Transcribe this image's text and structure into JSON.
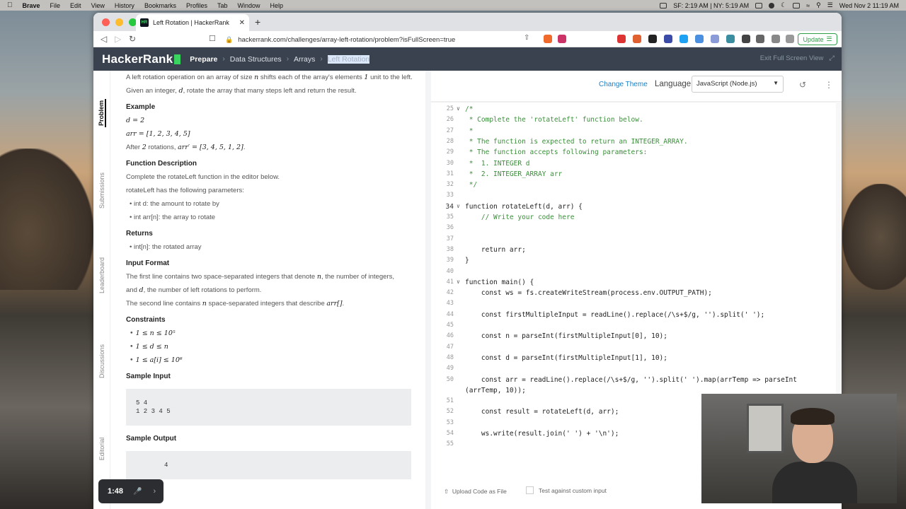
{
  "menubar": {
    "app": "Brave",
    "items": [
      "File",
      "Edit",
      "View",
      "History",
      "Bookmarks",
      "Profiles",
      "Tab",
      "Window",
      "Help"
    ],
    "clock": "SF: 2:19 AM | NY: 5:19 AM",
    "datetime": "Wed Nov 2  11:19 AM"
  },
  "browser": {
    "tab_title": "Left Rotation | HackerRank",
    "url": "hackerrank.com/challenges/array-left-rotation/problem?isFullScreen=true",
    "update_label": "Update"
  },
  "header": {
    "logo": "HackerRank",
    "breadcrumb": [
      "Prepare",
      "Data Structures",
      "Arrays",
      "Left Rotation"
    ],
    "exit": "Exit Full Screen View"
  },
  "sidebar": [
    "Problem",
    "Submissions",
    "Leaderboard",
    "Discussions",
    "Editorial"
  ],
  "problem": {
    "intro1": "A left rotation operation on an array of size ",
    "n": "n",
    "intro2": " shifts each of the array's elements ",
    "one": "1",
    "intro3": " unit to the left. Given an integer, ",
    "d": "d",
    "intro4": ", rotate the array that many steps left and return the result.",
    "example_h": "Example",
    "ex_d": "d = 2",
    "ex_arr": "arr = [1, 2, 3, 4, 5]",
    "after1": "After ",
    "after_n": "2",
    "after2": " rotations, ",
    "after_m": "arr′ = [3, 4, 5, 1, 2]",
    "after3": ".",
    "func_h": "Function Description",
    "func_p": "Complete the rotateLeft function in the editor below.",
    "params_p": "rotateLeft has the following parameters:",
    "params": [
      "int d: the amount to rotate by",
      "int arr[n]: the array to rotate"
    ],
    "returns_h": "Returns",
    "returns": [
      "int[n]: the rotated array"
    ],
    "input_h": "Input Format",
    "input1a": "The first line contains two space-separated integers that denote ",
    "input1n": "n",
    "input1b": ", the number of integers,",
    "input1c": "and ",
    "input1d": "d",
    "input1e": ", the number of left rotations to perform.",
    "input2a": "The second line contains ",
    "input2n": "n",
    "input2b": " space-separated integers that describe ",
    "input2m": "arr[]",
    "input2c": ".",
    "constraints_h": "Constraints",
    "constraints": [
      "1 ≤ n ≤ 10⁵",
      "1 ≤ d ≤ n",
      "1 ≤ a[i] ≤ 10⁶"
    ],
    "sample_in_h": "Sample Input",
    "sample_in": [
      "5 4",
      "1 2 3 4 5"
    ],
    "sample_out_h": "Sample Output",
    "sample_out": "4"
  },
  "editor": {
    "change_theme": "Change Theme",
    "language_label": "Language",
    "language": "JavaScript (Node.js)",
    "upload": "Upload Code as File",
    "custom_input": "Test against custom input"
  },
  "code": [
    {
      "n": "25",
      "t": "/*",
      "c": true,
      "fold": true
    },
    {
      "n": "26",
      "t": " * Complete the 'rotateLeft' function below.",
      "c": true
    },
    {
      "n": "27",
      "t": " *",
      "c": true
    },
    {
      "n": "28",
      "t": " * The function is expected to return an INTEGER_ARRAY.",
      "c": true
    },
    {
      "n": "29",
      "t": " * The function accepts following parameters:",
      "c": true
    },
    {
      "n": "30",
      "t": " *  1. INTEGER d",
      "c": true
    },
    {
      "n": "31",
      "t": " *  2. INTEGER_ARRAY arr",
      "c": true
    },
    {
      "n": "32",
      "t": " */",
      "c": true
    },
    {
      "n": "33",
      "t": ""
    },
    {
      "n": "34",
      "t": "function rotateLeft(d, arr) {",
      "fold": true,
      "big": true
    },
    {
      "n": "35",
      "t": "    // Write your code here",
      "c": true
    },
    {
      "n": "36",
      "t": ""
    },
    {
      "n": "37",
      "t": ""
    },
    {
      "n": "38",
      "t": "    return arr;"
    },
    {
      "n": "39",
      "t": "}"
    },
    {
      "n": "40",
      "t": ""
    },
    {
      "n": "41",
      "t": "function main() {",
      "fold": true
    },
    {
      "n": "42",
      "t": "    const ws = fs.createWriteStream(process.env.OUTPUT_PATH);"
    },
    {
      "n": "43",
      "t": ""
    },
    {
      "n": "44",
      "t": "    const firstMultipleInput = readLine().replace(/\\s+$/g, '').split(' ');"
    },
    {
      "n": "45",
      "t": ""
    },
    {
      "n": "46",
      "t": "    const n = parseInt(firstMultipleInput[0], 10);"
    },
    {
      "n": "47",
      "t": ""
    },
    {
      "n": "48",
      "t": "    const d = parseInt(firstMultipleInput[1], 10);"
    },
    {
      "n": "49",
      "t": ""
    },
    {
      "n": "50",
      "t": "    const arr = readLine().replace(/\\s+$/g, '').split(' ').map(arrTemp => parseInt"
    },
    {
      "n": "",
      "t": "(arrTemp, 10));"
    },
    {
      "n": "51",
      "t": ""
    },
    {
      "n": "52",
      "t": "    const result = rotateLeft(d, arr);"
    },
    {
      "n": "53",
      "t": ""
    },
    {
      "n": "54",
      "t": "    ws.write(result.join(' ') + '\\n');"
    },
    {
      "n": "55",
      "t": ""
    }
  ],
  "timer": "1:48"
}
